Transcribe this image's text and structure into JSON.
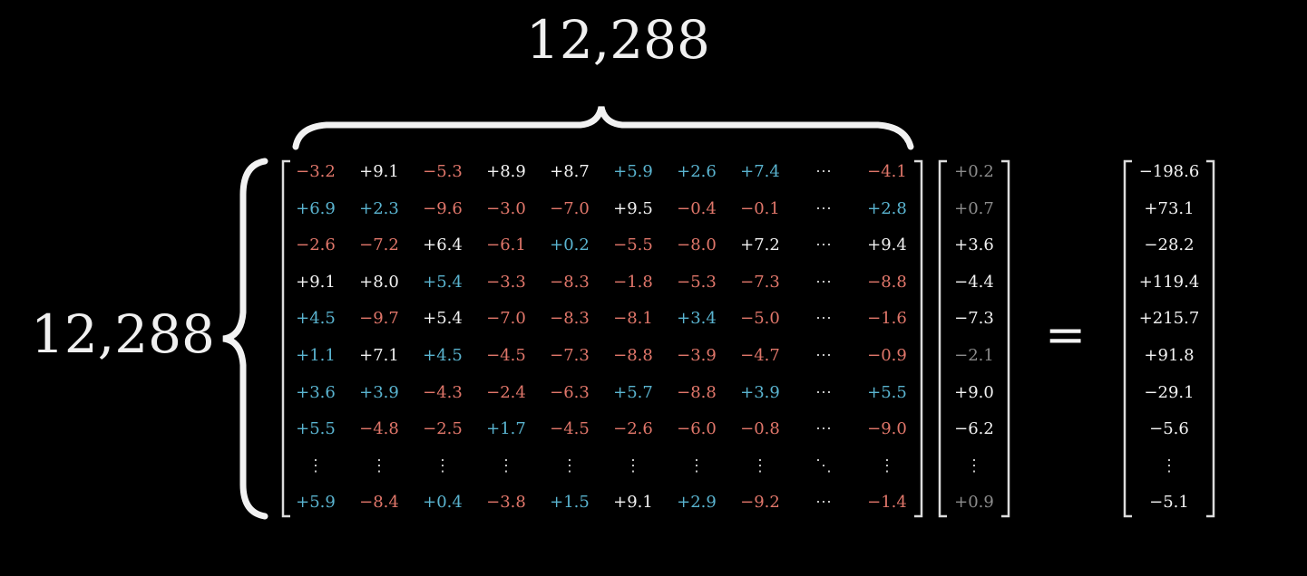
{
  "top_dimension": "12,288",
  "left_dimension": "12,288",
  "equals": "=",
  "colors": {
    "red": "#e0766a",
    "blue": "#5ab4d0",
    "white": "#f2f2f2",
    "gray": "#8c8c8c"
  },
  "matrix": [
    [
      [
        "−3.2",
        "red"
      ],
      [
        "+9.1",
        "white"
      ],
      [
        "−5.3",
        "red"
      ],
      [
        "+8.9",
        "white"
      ],
      [
        "+8.7",
        "white"
      ],
      [
        "+5.9",
        "blue"
      ],
      [
        "+2.6",
        "blue"
      ],
      [
        "+7.4",
        "blue"
      ],
      [
        "⋯",
        "dots"
      ],
      [
        "−4.1",
        "red"
      ]
    ],
    [
      [
        "+6.9",
        "blue"
      ],
      [
        "+2.3",
        "blue"
      ],
      [
        "−9.6",
        "red"
      ],
      [
        "−3.0",
        "red"
      ],
      [
        "−7.0",
        "red"
      ],
      [
        "+9.5",
        "white"
      ],
      [
        "−0.4",
        "red"
      ],
      [
        "−0.1",
        "red"
      ],
      [
        "⋯",
        "dots"
      ],
      [
        "+2.8",
        "blue"
      ]
    ],
    [
      [
        "−2.6",
        "red"
      ],
      [
        "−7.2",
        "red"
      ],
      [
        "+6.4",
        "white"
      ],
      [
        "−6.1",
        "red"
      ],
      [
        "+0.2",
        "blue"
      ],
      [
        "−5.5",
        "red"
      ],
      [
        "−8.0",
        "red"
      ],
      [
        "+7.2",
        "white"
      ],
      [
        "⋯",
        "dots"
      ],
      [
        "+9.4",
        "white"
      ]
    ],
    [
      [
        "+9.1",
        "white"
      ],
      [
        "+8.0",
        "white"
      ],
      [
        "+5.4",
        "blue"
      ],
      [
        "−3.3",
        "red"
      ],
      [
        "−8.3",
        "red"
      ],
      [
        "−1.8",
        "red"
      ],
      [
        "−5.3",
        "red"
      ],
      [
        "−7.3",
        "red"
      ],
      [
        "⋯",
        "dots"
      ],
      [
        "−8.8",
        "red"
      ]
    ],
    [
      [
        "+4.5",
        "blue"
      ],
      [
        "−9.7",
        "red"
      ],
      [
        "+5.4",
        "white"
      ],
      [
        "−7.0",
        "red"
      ],
      [
        "−8.3",
        "red"
      ],
      [
        "−8.1",
        "red"
      ],
      [
        "+3.4",
        "blue"
      ],
      [
        "−5.0",
        "red"
      ],
      [
        "⋯",
        "dots"
      ],
      [
        "−1.6",
        "red"
      ]
    ],
    [
      [
        "+1.1",
        "blue"
      ],
      [
        "+7.1",
        "white"
      ],
      [
        "+4.5",
        "blue"
      ],
      [
        "−4.5",
        "red"
      ],
      [
        "−7.3",
        "red"
      ],
      [
        "−8.8",
        "red"
      ],
      [
        "−3.9",
        "red"
      ],
      [
        "−4.7",
        "red"
      ],
      [
        "⋯",
        "dots"
      ],
      [
        "−0.9",
        "red"
      ]
    ],
    [
      [
        "+3.6",
        "blue"
      ],
      [
        "+3.9",
        "blue"
      ],
      [
        "−4.3",
        "red"
      ],
      [
        "−2.4",
        "red"
      ],
      [
        "−6.3",
        "red"
      ],
      [
        "+5.7",
        "blue"
      ],
      [
        "−8.8",
        "red"
      ],
      [
        "+3.9",
        "blue"
      ],
      [
        "⋯",
        "dots"
      ],
      [
        "+5.5",
        "blue"
      ]
    ],
    [
      [
        "+5.5",
        "blue"
      ],
      [
        "−4.8",
        "red"
      ],
      [
        "−2.5",
        "red"
      ],
      [
        "+1.7",
        "blue"
      ],
      [
        "−4.5",
        "red"
      ],
      [
        "−2.6",
        "red"
      ],
      [
        "−6.0",
        "red"
      ],
      [
        "−0.8",
        "red"
      ],
      [
        "⋯",
        "dots"
      ],
      [
        "−9.0",
        "red"
      ]
    ],
    [
      [
        "⋮",
        "dots"
      ],
      [
        "⋮",
        "dots"
      ],
      [
        "⋮",
        "dots"
      ],
      [
        "⋮",
        "dots"
      ],
      [
        "⋮",
        "dots"
      ],
      [
        "⋮",
        "dots"
      ],
      [
        "⋮",
        "dots"
      ],
      [
        "⋮",
        "dots"
      ],
      [
        "⋱",
        "dots"
      ],
      [
        "⋮",
        "dots"
      ]
    ],
    [
      [
        "+5.9",
        "blue"
      ],
      [
        "−8.4",
        "red"
      ],
      [
        "+0.4",
        "blue"
      ],
      [
        "−3.8",
        "red"
      ],
      [
        "+1.5",
        "blue"
      ],
      [
        "+9.1",
        "white"
      ],
      [
        "+2.9",
        "blue"
      ],
      [
        "−9.2",
        "red"
      ],
      [
        "⋯",
        "dots"
      ],
      [
        "−1.4",
        "red"
      ]
    ]
  ],
  "vector": [
    [
      "+0.2",
      "gray"
    ],
    [
      "+0.7",
      "gray"
    ],
    [
      "+3.6",
      "white"
    ],
    [
      "−4.4",
      "white"
    ],
    [
      "−7.3",
      "white"
    ],
    [
      "−2.1",
      "gray"
    ],
    [
      "+9.0",
      "white"
    ],
    [
      "−6.2",
      "white"
    ],
    [
      "⋮",
      "dots"
    ],
    [
      "+0.9",
      "gray"
    ]
  ],
  "result": [
    "−198.6",
    "+73.1",
    "−28.2",
    "+119.4",
    "+215.7",
    "+91.8",
    "−29.1",
    "−5.6",
    "⋮",
    "−5.1"
  ]
}
